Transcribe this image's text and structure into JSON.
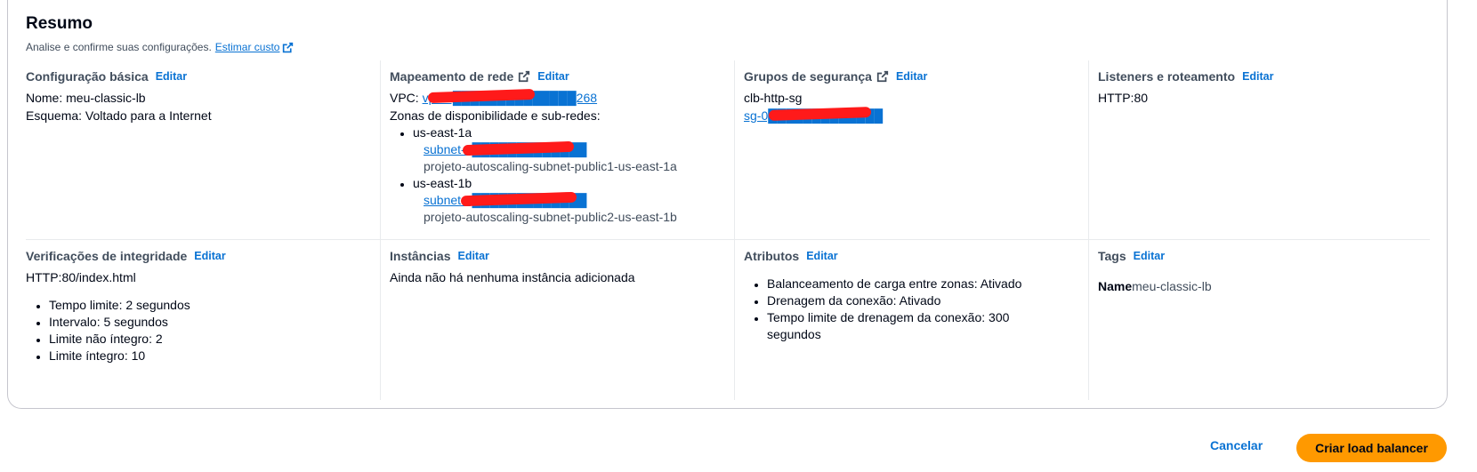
{
  "summary": {
    "title": "Resumo",
    "subtitle": "Analise e confirme suas configurações.",
    "estimate_link": "Estimar custo"
  },
  "edit_label": "Editar",
  "basic": {
    "heading": "Configuração básica",
    "name_line": "Nome: meu-classic-lb",
    "scheme_line": "Esquema: Voltado para a Internet"
  },
  "network": {
    "heading": "Mapeamento de rede",
    "vpc_label": "VPC:",
    "vpc_link": "vpc-0██████████████268",
    "zones_label": "Zonas de disponibilidade e sub-redes:",
    "zones": [
      {
        "az": "us-east-1a",
        "subnet_link": "subnet-0█████████████",
        "subnet_name": "projeto-autoscaling-subnet-public1-us-east-1a"
      },
      {
        "az": "us-east-1b",
        "subnet_link": "subnet-0█████████████",
        "subnet_name": "projeto-autoscaling-subnet-public2-us-east-1b"
      }
    ]
  },
  "security": {
    "heading": "Grupos de segurança",
    "group_name": "clb-http-sg",
    "group_link": "sg-0█████████████"
  },
  "listeners": {
    "heading": "Listeners e roteamento",
    "value": "HTTP:80"
  },
  "health": {
    "heading": "Verificações de integridade",
    "path": "HTTP:80/index.html",
    "items": [
      "Tempo limite: 2 segundos",
      "Intervalo: 5 segundos",
      "Limite não íntegro: 2",
      "Limite íntegro: 10"
    ]
  },
  "instances": {
    "heading": "Instâncias",
    "empty_text": "Ainda não há nenhuma instância adicionada"
  },
  "attributes": {
    "heading": "Atributos",
    "items": [
      "Balanceamento de carga entre zonas: Ativado",
      "Drenagem da conexão: Ativado",
      "Tempo limite de drenagem da conexão: 300 segundos"
    ]
  },
  "tags": {
    "heading": "Tags",
    "key": "Name",
    "value": "meu-classic-lb"
  },
  "footer": {
    "cancel": "Cancelar",
    "create": "Criar load balancer"
  },
  "colors": {
    "link": "#0972d3",
    "primary_button": "#ff9900",
    "redaction": "#ff1a1a"
  },
  "icons": {
    "external": "external-link-icon"
  }
}
